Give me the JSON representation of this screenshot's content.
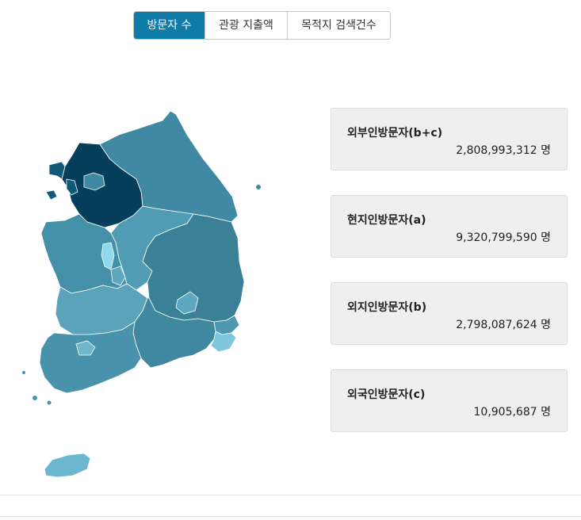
{
  "tabs": [
    {
      "label": "방문자 수",
      "active": true
    },
    {
      "label": "관광 지출액",
      "active": false
    },
    {
      "label": "목적지 검색건수",
      "active": false
    }
  ],
  "map": {
    "regions": [
      {
        "name": "gangwon",
        "color": "#3f8aa2"
      },
      {
        "name": "gyeonggi",
        "color": "#053f5c"
      },
      {
        "name": "incheon",
        "color": "#0f5a78"
      },
      {
        "name": "seoul",
        "color": "#3f8aa2"
      },
      {
        "name": "chungnam",
        "color": "#4590a9"
      },
      {
        "name": "chungbuk",
        "color": "#4f9cb4"
      },
      {
        "name": "sejong",
        "color": "#8fd8ec"
      },
      {
        "name": "daejeon",
        "color": "#5ea8bf"
      },
      {
        "name": "gyeongbuk",
        "color": "#3a8198"
      },
      {
        "name": "daegu",
        "color": "#5ea8bf"
      },
      {
        "name": "jeonbuk",
        "color": "#5aa3bb"
      },
      {
        "name": "jeonnam",
        "color": "#4893ab"
      },
      {
        "name": "gwangju",
        "color": "#6fb7cc"
      },
      {
        "name": "gyeongnam",
        "color": "#3f88a0"
      },
      {
        "name": "ulsan",
        "color": "#4e98b0"
      },
      {
        "name": "busan",
        "color": "#7ec6dc"
      },
      {
        "name": "jeju",
        "color": "#6cb6cf"
      }
    ]
  },
  "cards": [
    {
      "title": "외부인방문자(b+c)",
      "value": "2,808,993,312 명"
    },
    {
      "title": "현지인방문자(a)",
      "value": "9,320,799,590 명"
    },
    {
      "title": "외지인방문자(b)",
      "value": "2,798,087,624 명"
    },
    {
      "title": "외국인방문자(c)",
      "value": "10,905,687 명"
    }
  ]
}
